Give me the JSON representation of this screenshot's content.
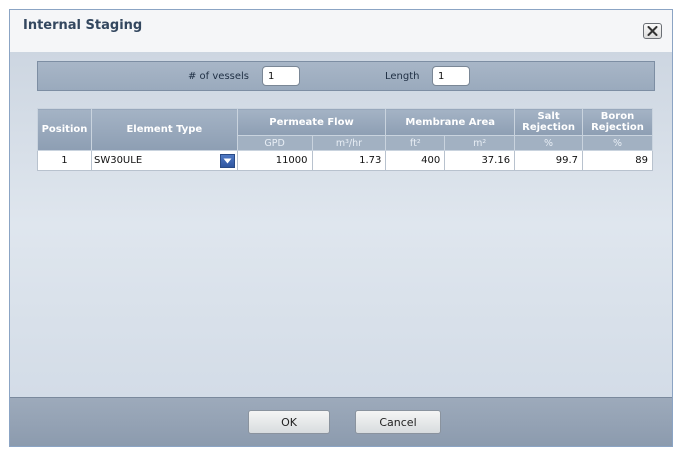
{
  "dialog": {
    "title": "Internal Staging"
  },
  "vessels": {
    "vessels_label": "# of vessels",
    "vessels_value": "1",
    "length_label": "Length",
    "length_value": "1"
  },
  "table": {
    "headers": {
      "position": "Position",
      "element_type": "Element Type",
      "permeate_flow": "Permeate Flow",
      "membrane_area": "Membrane Area",
      "salt_rejection": "Salt Rejection",
      "boron_rejection": "Boron Rejection"
    },
    "units": {
      "flow_gpd": "GPD",
      "flow_m3hr": "m³/hr",
      "area_ft2": "ft²",
      "area_m2": "m²",
      "salt_pct": "%",
      "boron_pct": "%"
    },
    "rows": [
      {
        "position": "1",
        "element_type": "SW30ULE",
        "flow_gpd": "11000",
        "flow_m3hr": "1.73",
        "area_ft2": "400",
        "area_m2": "37.16",
        "salt_rejection": "99.7",
        "boron_rejection": "89"
      }
    ]
  },
  "footer": {
    "ok_label": "OK",
    "cancel_label": "Cancel"
  }
}
